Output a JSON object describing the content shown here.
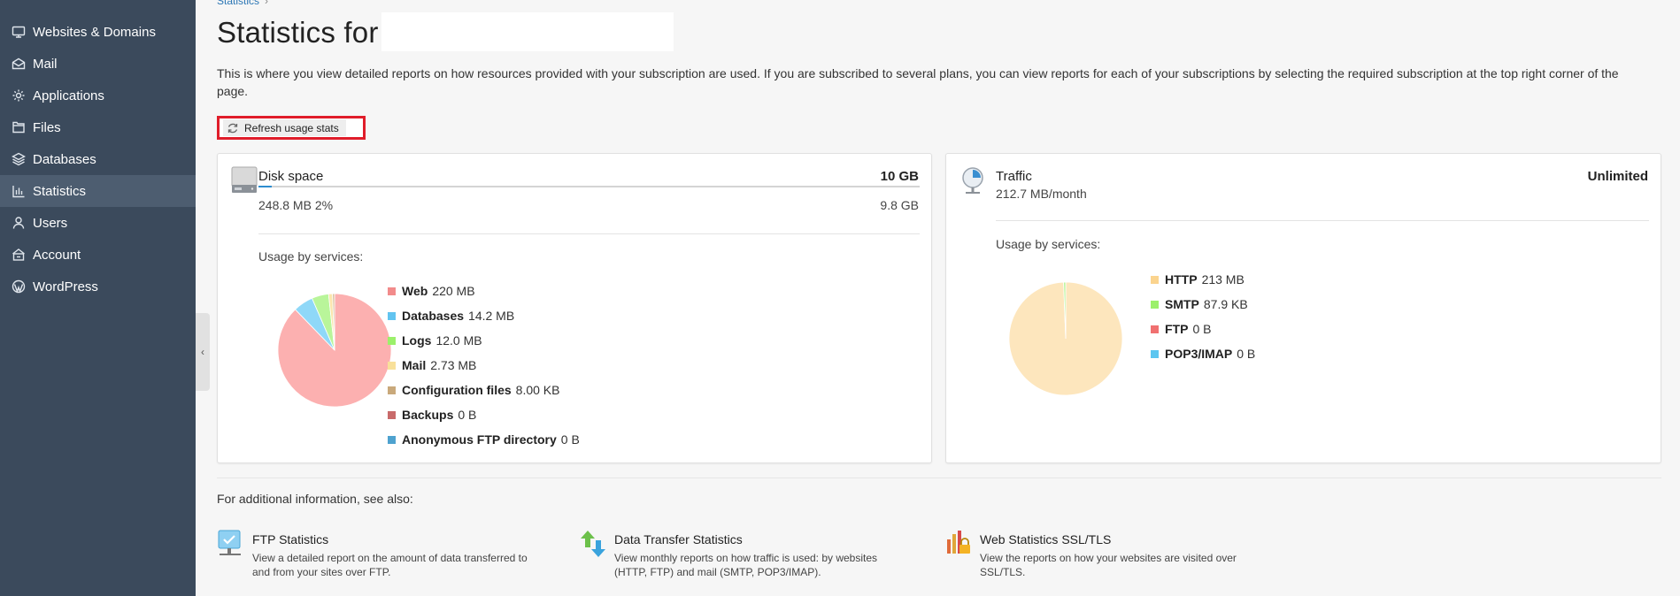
{
  "sidebar": {
    "items": [
      {
        "label": "Websites & Domains",
        "icon": "monitor-icon"
      },
      {
        "label": "Mail",
        "icon": "envelope-icon"
      },
      {
        "label": "Applications",
        "icon": "gear-icon"
      },
      {
        "label": "Files",
        "icon": "folder-icon"
      },
      {
        "label": "Databases",
        "icon": "layers-icon"
      },
      {
        "label": "Statistics",
        "icon": "bar-chart-icon",
        "active": true
      },
      {
        "label": "Users",
        "icon": "user-icon"
      },
      {
        "label": "Account",
        "icon": "account-icon"
      },
      {
        "label": "WordPress",
        "icon": "wordpress-icon"
      }
    ],
    "collapse_glyph": "‹"
  },
  "breadcrumb": {
    "item": "Statistics",
    "sep": "›"
  },
  "page": {
    "title": "Statistics for",
    "intro": "This is where you view detailed reports on how resources provided with your subscription are used. If you are subscribed to several plans, you can view reports for each of your subscriptions by selecting the required subscription at the top right corner of the page.",
    "refresh_label": "Refresh usage stats"
  },
  "disk": {
    "title": "Disk space",
    "limit": "10 GB",
    "used": "248.8 MB 2%",
    "remaining": "9.8 GB",
    "used_fraction": 0.02,
    "usage_label": "Usage by services:",
    "legend": [
      {
        "name": "Web",
        "value": "220 MB",
        "color": "#f28b8b"
      },
      {
        "name": "Databases",
        "value": "14.2 MB",
        "color": "#62c4f0"
      },
      {
        "name": "Logs",
        "value": "12.0 MB",
        "color": "#9cf06b"
      },
      {
        "name": "Mail",
        "value": "2.73 MB",
        "color": "#f8e09a"
      },
      {
        "name": "Configuration files",
        "value": "8.00 KB",
        "color": "#c9a97b"
      },
      {
        "name": "Backups",
        "value": "0 B",
        "color": "#c86a6a"
      },
      {
        "name": "Anonymous FTP directory",
        "value": "0 B",
        "color": "#4ea2cf"
      }
    ]
  },
  "traffic": {
    "title": "Traffic",
    "limit": "Unlimited",
    "used": "212.7 MB/month",
    "usage_label": "Usage by services:",
    "legend": [
      {
        "name": "HTTP",
        "value": "213 MB",
        "color": "#fbd48e"
      },
      {
        "name": "SMTP",
        "value": "87.9 KB",
        "color": "#9cf06b"
      },
      {
        "name": "FTP",
        "value": "0 B",
        "color": "#f07070"
      },
      {
        "name": "POP3/IMAP",
        "value": "0 B",
        "color": "#5cc6f0"
      }
    ]
  },
  "chart_data": [
    {
      "type": "pie",
      "categories": [
        "Web",
        "Databases",
        "Logs",
        "Mail",
        "Configuration files",
        "Backups",
        "Anonymous FTP directory"
      ],
      "values": [
        220,
        14.2,
        12.0,
        2.73,
        0.008,
        0,
        0
      ],
      "colors": [
        "#fcb0b0",
        "#8fd8f8",
        "#b9f59a",
        "#fbe6ad",
        "#d8c09c",
        "#d88c8c",
        "#7ab8dc"
      ]
    },
    {
      "type": "pie",
      "categories": [
        "HTTP",
        "SMTP",
        "FTP",
        "POP3/IMAP"
      ],
      "values": [
        213,
        0.0879,
        0,
        0
      ],
      "colors": [
        "#fde6bd",
        "#b9f59a",
        "#f59a9a",
        "#9ad8f4"
      ]
    }
  ],
  "see_also": {
    "label": "For additional information, see also:",
    "links": [
      {
        "title": "FTP Statistics",
        "desc": "View a detailed report on the amount of data transferred to and from your sites over FTP.",
        "icon": "ftp-stats-icon"
      },
      {
        "title": "Data Transfer Statistics",
        "desc": "View monthly reports on how traffic is used: by websites (HTTP, FTP) and mail (SMTP, POP3/IMAP).",
        "icon": "data-transfer-icon"
      },
      {
        "title": "Web Statistics SSL/TLS",
        "desc": "View the reports on how your websites are visited over SSL/TLS.",
        "icon": "web-stats-ssl-icon"
      }
    ]
  }
}
